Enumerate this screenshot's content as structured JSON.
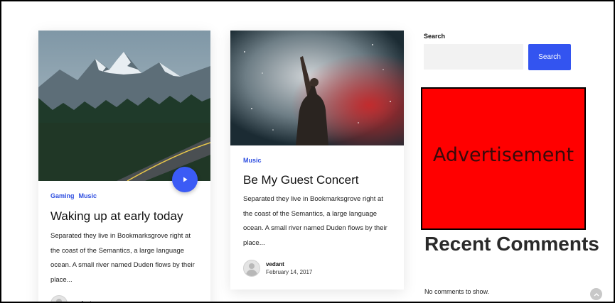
{
  "posts": [
    {
      "categories": [
        "Gaming",
        "Music"
      ],
      "title": "Waking up at early today",
      "excerpt": "Separated they live in Bookmarksgrove right at the coast of the Semantics, a large language ocean. A small river named Duden flows by their place...",
      "author": "vedant",
      "date": "",
      "has_play_button": true
    },
    {
      "categories": [
        "Music"
      ],
      "title": "Be My Guest Concert",
      "excerpt": "Separated they live in Bookmarksgrove right at the coast of the Semantics, a large language ocean. A small river named Duden flows by their place...",
      "author": "vedant",
      "date": "February 14, 2017",
      "has_play_button": false
    }
  ],
  "sidebar": {
    "search_heading": "Search",
    "search_placeholder": "",
    "search_button": "Search",
    "ad_label": "Advertisement",
    "recent_comments_heading": "Recent Comments",
    "recent_comments_empty": "No comments to show."
  },
  "colors": {
    "accent": "#3354f0",
    "ad_background": "#ff0000"
  },
  "icons": {
    "play": "play-icon",
    "avatar": "avatar-placeholder-icon",
    "scroll_top": "chevron-up-icon"
  }
}
